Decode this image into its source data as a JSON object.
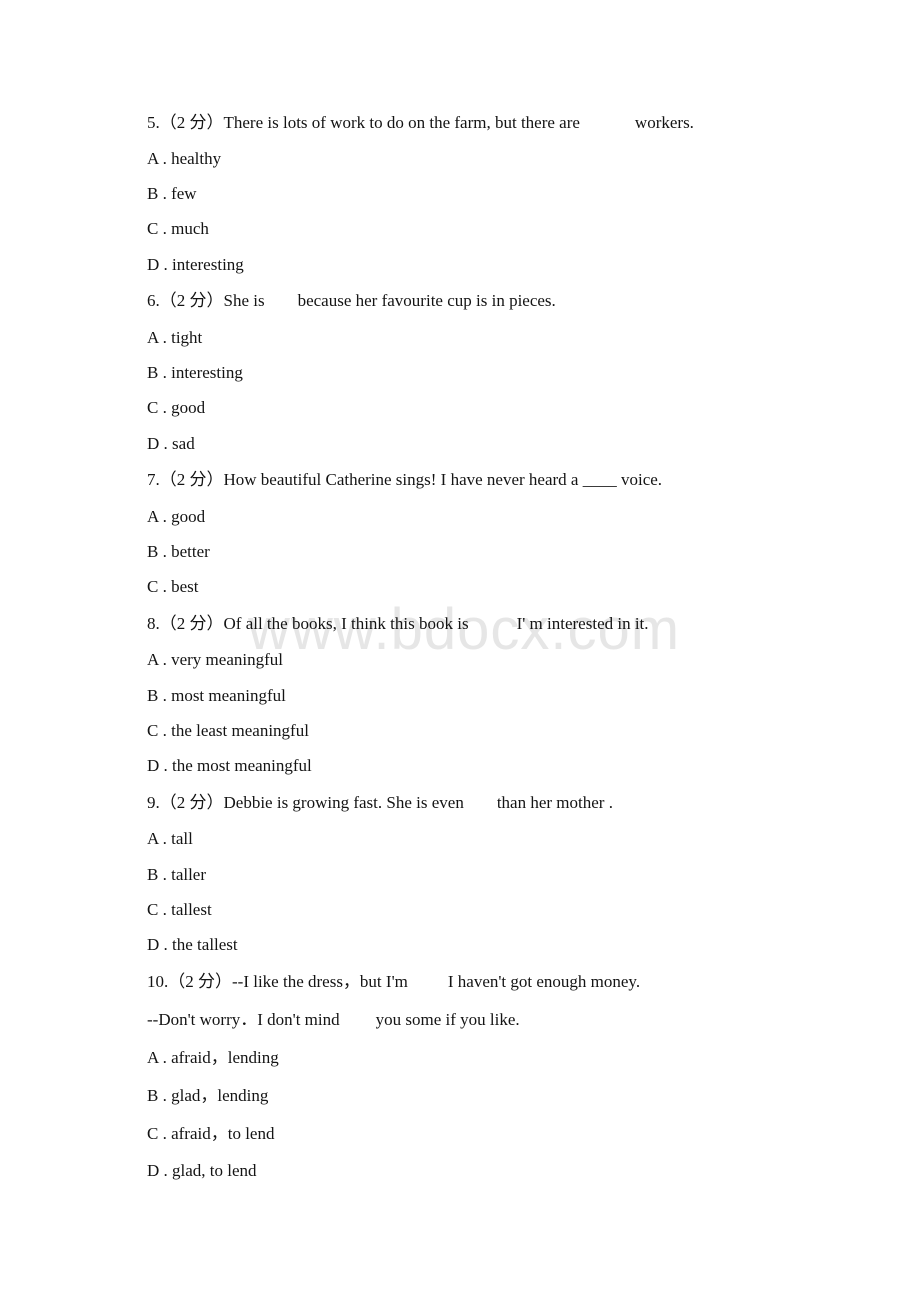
{
  "watermark": "www.bdocx.com",
  "questions": [
    {
      "number": "5.",
      "points": "（2 分）",
      "stem_before": "There is lots of work to do on the farm, but there are",
      "stem_after": "workers.",
      "options": [
        {
          "label": "A .",
          "text": "healthy"
        },
        {
          "label": "B .",
          "text": "few"
        },
        {
          "label": "C .",
          "text": "much"
        },
        {
          "label": "D .",
          "text": "interesting"
        }
      ]
    },
    {
      "number": "6.",
      "points": "（2 分）",
      "stem_before": "She is",
      "stem_after": "because her favourite cup is in pieces.",
      "options": [
        {
          "label": "A .",
          "text": "tight"
        },
        {
          "label": "B .",
          "text": "interesting"
        },
        {
          "label": "C .",
          "text": "good"
        },
        {
          "label": "D .",
          "text": "sad"
        }
      ]
    },
    {
      "number": "7.",
      "points": "（2 分）",
      "stem": "How beautiful Catherine sings! I have never heard a ____ voice.",
      "options": [
        {
          "label": "A .",
          "text": "good"
        },
        {
          "label": "B .",
          "text": "better"
        },
        {
          "label": "C .",
          "text": "best"
        }
      ]
    },
    {
      "number": "8.",
      "points": "（2 分）",
      "stem_before": "Of all the books, I think this book is",
      "stem_after": "I' m interested in it.",
      "options": [
        {
          "label": "A .",
          "text": "very meaningful"
        },
        {
          "label": "B .",
          "text": "most meaningful"
        },
        {
          "label": "C .",
          "text": "the least meaningful"
        },
        {
          "label": "D .",
          "text": "the most meaningful"
        }
      ]
    },
    {
      "number": "9.",
      "points": "（2 分）",
      "stem_before": "Debbie is growing fast. She is even",
      "stem_after": "than her mother .",
      "options": [
        {
          "label": "A .",
          "text": "tall"
        },
        {
          "label": "B .",
          "text": "taller"
        },
        {
          "label": "C .",
          "text": "tallest"
        },
        {
          "label": "D .",
          "text": "the tallest"
        }
      ]
    },
    {
      "number": "10.",
      "points": "（2 分）",
      "stem_before": "--I like the dress，but I'm",
      "stem_after": "I haven't got enough money.",
      "stem2_before": "--Don't worry．I don't mind",
      "stem2_after": "you some if you like.",
      "options": [
        {
          "label": "A .",
          "text": "afraid，lending"
        },
        {
          "label": "B .",
          "text": "glad，lending"
        },
        {
          "label": "C .",
          "text": "afraid，to lend"
        },
        {
          "label": "D .",
          "text": "glad, to lend"
        }
      ]
    }
  ]
}
